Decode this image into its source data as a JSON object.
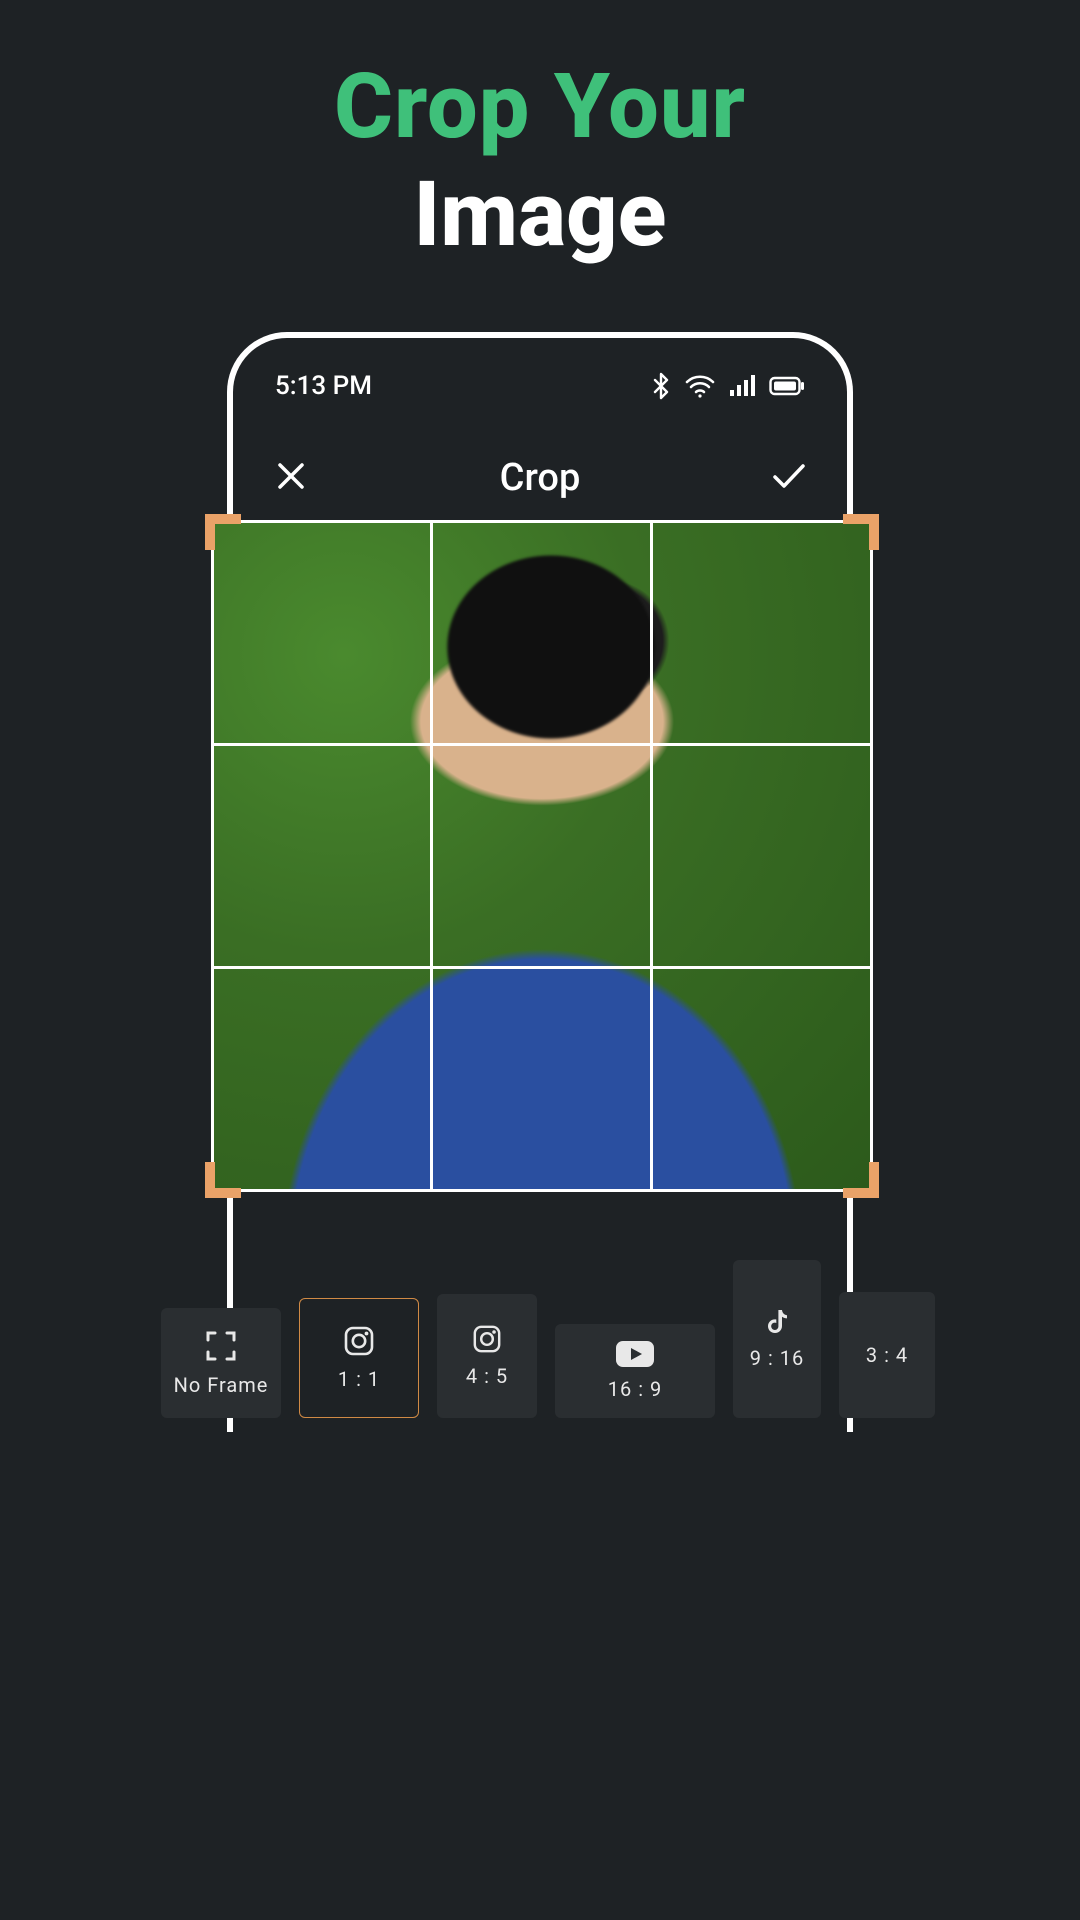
{
  "promo": {
    "line1": "Crop Your",
    "line2": "Image"
  },
  "statusbar": {
    "time": "5:13 PM"
  },
  "appbar": {
    "title": "Crop"
  },
  "ratios": {
    "noframe": "No Frame",
    "one_one": "1 : 1",
    "four_five": "4 : 5",
    "sixteen_nine": "16 : 9",
    "nine_sixteen": "9 : 16",
    "three_four": "3 : 4"
  },
  "colors": {
    "accent_green": "#3fc07a",
    "handle_orange": "#eaa268",
    "bg": "#1e2225"
  }
}
